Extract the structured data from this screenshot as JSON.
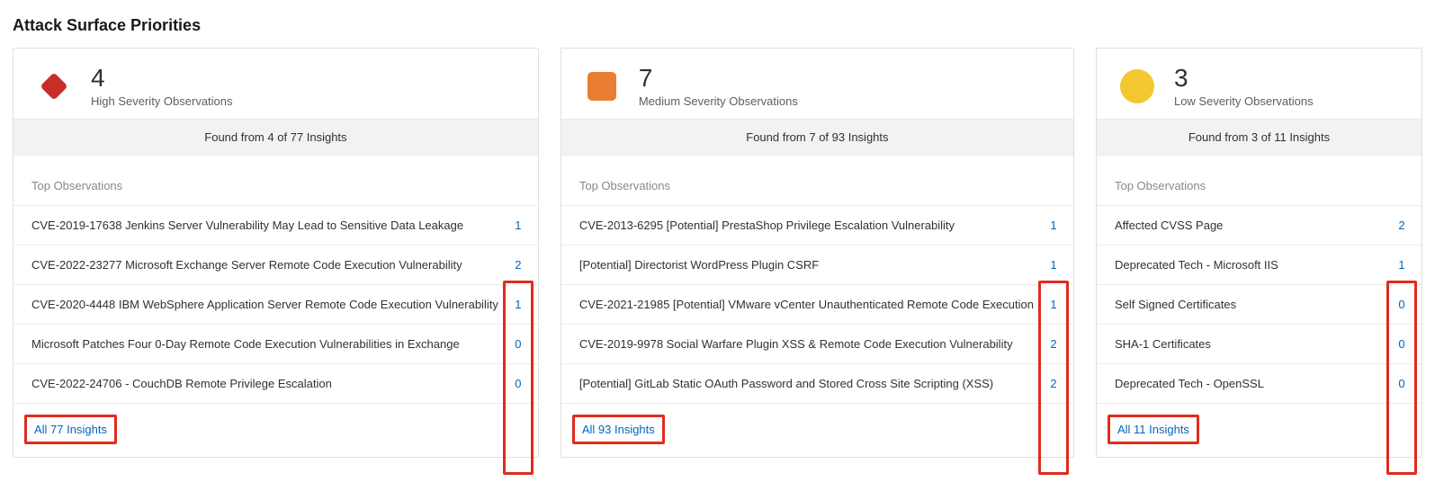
{
  "page_title": "Attack Surface Priorities",
  "cards": [
    {
      "count": "4",
      "label": "High Severity Observations",
      "found_text": "Found from 4 of 77 Insights",
      "section_label": "Top Observations",
      "observations": [
        {
          "text": "CVE-2019-17638 Jenkins Server Vulnerability May Lead to Sensitive Data Leakage",
          "count": "1"
        },
        {
          "text": "CVE-2022-23277 Microsoft Exchange Server Remote Code Execution Vulnerability",
          "count": "2"
        },
        {
          "text": "CVE-2020-4448 IBM WebSphere Application Server Remote Code Execution Vulnerability",
          "count": "1"
        },
        {
          "text": "Microsoft Patches Four 0-Day Remote Code Execution Vulnerabilities in Exchange",
          "count": "0"
        },
        {
          "text": "CVE-2022-24706 - CouchDB Remote Privilege Escalation",
          "count": "0"
        }
      ],
      "all_link": "All 77 Insights"
    },
    {
      "count": "7",
      "label": "Medium Severity Observations",
      "found_text": "Found from 7 of 93 Insights",
      "section_label": "Top Observations",
      "observations": [
        {
          "text": "CVE-2013-6295 [Potential] PrestaShop Privilege Escalation Vulnerability",
          "count": "1"
        },
        {
          "text": "[Potential] Directorist WordPress Plugin CSRF",
          "count": "1"
        },
        {
          "text": "CVE-2021-21985 [Potential] VMware vCenter Unauthenticated Remote Code Execution",
          "count": "1"
        },
        {
          "text": "CVE-2019-9978 Social Warfare Plugin XSS & Remote Code Execution Vulnerability",
          "count": "2"
        },
        {
          "text": "[Potential] GitLab Static OAuth Password and Stored Cross Site Scripting (XSS)",
          "count": "2"
        }
      ],
      "all_link": "All 93 Insights"
    },
    {
      "count": "3",
      "label": "Low Severity Observations",
      "found_text": "Found from 3 of 11 Insights",
      "section_label": "Top Observations",
      "observations": [
        {
          "text": "Affected CVSS Page",
          "count": "2"
        },
        {
          "text": "Deprecated Tech - Microsoft IIS",
          "count": "1"
        },
        {
          "text": "Self Signed Certificates",
          "count": "0"
        },
        {
          "text": "SHA-1 Certificates",
          "count": "0"
        },
        {
          "text": "Deprecated Tech - OpenSSL",
          "count": "0"
        }
      ],
      "all_link": "All 11 Insights"
    }
  ],
  "severity_colors": {
    "high": "#c72e27",
    "medium": "#e97e32",
    "low": "#f2c730"
  }
}
